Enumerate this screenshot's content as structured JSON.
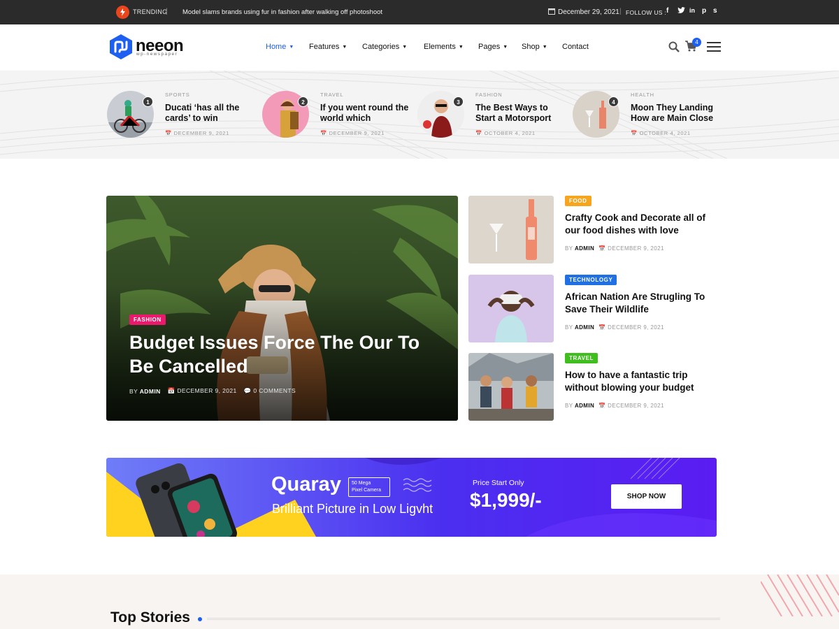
{
  "topbar": {
    "trending_label": "TRENDING",
    "trending_news": "Model slams brands using fur in fashion after walking off photoshoot",
    "date": "December 29, 2021",
    "follow_label": "FOLLOW US :",
    "social": [
      "f",
      "t",
      "in",
      "p",
      "s"
    ]
  },
  "header": {
    "logo": "neeon",
    "logo_sub": "wp-newspaper",
    "nav": [
      {
        "label": "Home",
        "active": true
      },
      {
        "label": "Features"
      },
      {
        "label": "Categories"
      },
      {
        "label": "Elements"
      },
      {
        "label": "Pages"
      },
      {
        "label": "Shop"
      },
      {
        "label": "Contact"
      }
    ],
    "cart_count": "4"
  },
  "trending": [
    {
      "num": "1",
      "category": "SPORTS",
      "title": "Ducati ‘has all the cards’ to win",
      "date": "DECEMBER 9, 2021"
    },
    {
      "num": "2",
      "category": "TRAVEL",
      "title": "If you went round the world which",
      "date": "DECEMBER 9, 2021"
    },
    {
      "num": "3",
      "category": "FASHION",
      "title": "The Best Ways to Start a Motorsport",
      "date": "OCTOBER 4, 2021"
    },
    {
      "num": "4",
      "category": "HEALTH",
      "title": "Moon They Landing How are Main Close",
      "date": "OCTOBER 4, 2021"
    }
  ],
  "featured": {
    "category": "FASHION",
    "title": "Budget Issues Force The Our To Be Cancelled",
    "by": "BY",
    "author": "ADMIN",
    "date": "DECEMBER 9, 2021",
    "comments": "0 COMMENTS"
  },
  "side_posts": [
    {
      "category": "FOOD",
      "cat_color": "#f6a51e",
      "title": "Crafty Cook and Decorate all of our food dishes with love",
      "by": "BY",
      "author": "ADMIN",
      "date": "DECEMBER 9, 2021"
    },
    {
      "category": "TECHNOLOGY",
      "cat_color": "#1f6fe5",
      "title": "African Nation Are Strugling To Save Their Wildlife",
      "by": "BY",
      "author": "ADMIN",
      "date": "DECEMBER 9, 2021"
    },
    {
      "category": "TRAVEL",
      "cat_color": "#3fbf1e",
      "title": "How to have a fantastic trip without blowing your budget",
      "by": "BY",
      "author": "ADMIN",
      "date": "DECEMBER 9, 2021"
    }
  ],
  "banner": {
    "brand": "Quaray",
    "tag_line1": "50 Mega",
    "tag_line2": "Pixel Camera",
    "subtitle": "Brilliant Picture in Low Ligvht",
    "price_label": "Price Start Only",
    "price": "$1,999/-",
    "button": "SHOP NOW"
  },
  "section": {
    "title": "Top Stories"
  },
  "colors": {
    "accent": "#1d5ff0",
    "topbar": "#2b2b2b",
    "fashion": "#e9196b"
  }
}
